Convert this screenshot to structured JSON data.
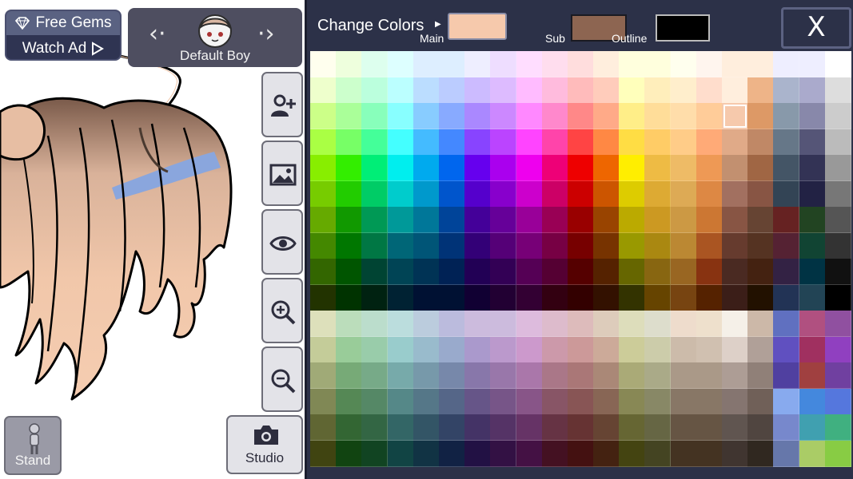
{
  "header": {
    "free_gems_label": "Free Gems",
    "watch_ad_label": "Watch Ad",
    "character_name": "Default Boy",
    "prev_arrow": "‹·",
    "next_arrow": "·›"
  },
  "side_buttons": [
    {
      "name": "add-character-button",
      "icon": "add-user-icon"
    },
    {
      "name": "background-button",
      "icon": "image-icon"
    },
    {
      "name": "visibility-button",
      "icon": "eye-icon"
    },
    {
      "name": "zoom-in-button",
      "icon": "zoom-in-icon"
    },
    {
      "name": "zoom-out-button",
      "icon": "zoom-out-icon"
    }
  ],
  "bottom_buttons": {
    "stand_label": "Stand",
    "studio_label": "Studio"
  },
  "color_panel": {
    "title": "Change Colors",
    "main_label": "Main",
    "sub_label": "Sub",
    "outline_label": "Outline",
    "close_label": "X",
    "main_color": "#f6c9ac",
    "sub_color": "#8d6551",
    "outline_color": "#000000",
    "selected_cell": {
      "row": 2,
      "col": 16
    }
  },
  "palette": {
    "rows": [
      [
        "#ffffee",
        "#eeffdd",
        "#ddffee",
        "#ddffff",
        "#ddeeff",
        "#ddeeff",
        "#eeeeff",
        "#eeddff",
        "#ffddff",
        "#ffddee",
        "#ffdddd",
        "#ffeedd",
        "#ffffdd",
        "#ffffdd",
        "#ffffee",
        "#fff5ee",
        "#ffeedd",
        "#ffeedd",
        "#eeeeff",
        "#eeeeff",
        "#ffffff"
      ],
      [
        "#eeffcc",
        "#ccffcc",
        "#bbffdd",
        "#bbffff",
        "#bbddff",
        "#bbccff",
        "#ccbbff",
        "#ddbbff",
        "#ffbbff",
        "#ffbbdd",
        "#ffbbbb",
        "#ffccbb",
        "#ffffbb",
        "#ffeebb",
        "#ffeecc",
        "#ffddcc",
        "#ffeedd",
        "#eeb488",
        "#aab4cc",
        "#aaaacc",
        "#dddddd"
      ],
      [
        "#ccff88",
        "#aaff99",
        "#88ffbb",
        "#88ffff",
        "#88ccff",
        "#88aaff",
        "#aa88ff",
        "#cc88ff",
        "#ff88ff",
        "#ff88cc",
        "#ff8888",
        "#ffaa88",
        "#ffee88",
        "#ffdd99",
        "#ffddaa",
        "#ffcc99",
        "#f6c9ac",
        "#dd9966",
        "#8899aa",
        "#8888aa",
        "#cccccc"
      ],
      [
        "#aaff44",
        "#77ff66",
        "#44ff99",
        "#44ffff",
        "#44bbff",
        "#4488ff",
        "#8844ff",
        "#bb44ff",
        "#ff44ff",
        "#ff44aa",
        "#ff4444",
        "#ff8844",
        "#ffdd44",
        "#ffcc66",
        "#ffcc88",
        "#ffaa77",
        "#e0aa88",
        "#c08866",
        "#667788",
        "#555577",
        "#bbbbbb"
      ],
      [
        "#88ee00",
        "#33ee00",
        "#00ee77",
        "#00eeee",
        "#00aaee",
        "#0066ee",
        "#6600ee",
        "#aa00ee",
        "#ee00ee",
        "#ee0077",
        "#ee0000",
        "#ee6600",
        "#ffee00",
        "#eebb44",
        "#eebb66",
        "#ee9955",
        "#c29070",
        "#a06644",
        "#445566",
        "#333355",
        "#999999"
      ],
      [
        "#77cc00",
        "#22cc00",
        "#00cc66",
        "#00cccc",
        "#0099cc",
        "#0055cc",
        "#5500cc",
        "#8800cc",
        "#cc00cc",
        "#cc0066",
        "#cc0000",
        "#cc5500",
        "#ddcc00",
        "#ddaa33",
        "#ddaa55",
        "#dd8844",
        "#a27060",
        "#885544",
        "#334455",
        "#222244",
        "#777777"
      ],
      [
        "#66aa00",
        "#119900",
        "#009955",
        "#009999",
        "#007799",
        "#004499",
        "#440099",
        "#660099",
        "#990099",
        "#990055",
        "#990000",
        "#994400",
        "#bbaa00",
        "#cc9922",
        "#cc9944",
        "#cc7733",
        "#885544",
        "#664433",
        "#662222",
        "#224422",
        "#555555"
      ],
      [
        "#448800",
        "#007700",
        "#007744",
        "#006677",
        "#005577",
        "#003377",
        "#330077",
        "#550077",
        "#770077",
        "#770044",
        "#770000",
        "#773300",
        "#999900",
        "#aa8811",
        "#bb8833",
        "#aa5522",
        "#663b2e",
        "#553322",
        "#552233",
        "#114433",
        "#333333"
      ],
      [
        "#336600",
        "#005500",
        "#004433",
        "#004455",
        "#003355",
        "#002255",
        "#220055",
        "#330055",
        "#550055",
        "#550033",
        "#550000",
        "#552200",
        "#666600",
        "#886611",
        "#996622",
        "#883311",
        "#4a2a22",
        "#442211",
        "#332244",
        "#003344",
        "#111111"
      ],
      [
        "#223300",
        "#003300",
        "#002211",
        "#002233",
        "#001133",
        "#001133",
        "#110033",
        "#220033",
        "#330033",
        "#330011",
        "#330000",
        "#331100",
        "#333300",
        "#664400",
        "#774411",
        "#552200",
        "#3b1e18",
        "#221100",
        "#223355",
        "#224455",
        "#000000"
      ],
      [
        "#dde0bb",
        "#bbddbb",
        "#bbddcc",
        "#bbdddd",
        "#bbccdd",
        "#bbbbdd",
        "#ccbbdd",
        "#ccbbdd",
        "#ddbbdd",
        "#ddbbcc",
        "#ddbbbb",
        "#ddccbb",
        "#ddddbb",
        "#ddddcc",
        "#eedccc",
        "#eee0cc",
        "#f5f0e8",
        "#ccb8a8",
        "#6070c0",
        "#b05080",
        "#9050a0"
      ],
      [
        "#c4cc99",
        "#99cc99",
        "#99ccaa",
        "#99cccc",
        "#99bbcc",
        "#99aacc",
        "#aa99cc",
        "#bb99cc",
        "#cc99cc",
        "#cc99aa",
        "#cc9999",
        "#ccaa99",
        "#cccc99",
        "#ccccaa",
        "#ccbbaa",
        "#d0c0b0",
        "#ddd0c8",
        "#b0a098",
        "#6050c0",
        "#a03060",
        "#9040c0"
      ],
      [
        "#a0aa77",
        "#77aa77",
        "#77aa88",
        "#77aaaa",
        "#7799aa",
        "#7788aa",
        "#8877aa",
        "#9977aa",
        "#aa77aa",
        "#aa7788",
        "#aa7777",
        "#aa8877",
        "#aaaa77",
        "#aaaa88",
        "#aa9988",
        "#aa9988",
        "#ad9d95",
        "#908078",
        "#5040a0",
        "#a04040",
        "#7040a0"
      ],
      [
        "#808855",
        "#558855",
        "#558866",
        "#558888",
        "#557788",
        "#556688",
        "#665588",
        "#775588",
        "#885588",
        "#885566",
        "#885555",
        "#886655",
        "#888855",
        "#888866",
        "#887766",
        "#887766",
        "#857570",
        "#706058",
        "#88aaee",
        "#4488dd",
        "#5577dd"
      ],
      [
        "#606633",
        "#336633",
        "#336644",
        "#336666",
        "#335566",
        "#334466",
        "#443366",
        "#553366",
        "#663366",
        "#663344",
        "#663333",
        "#664433",
        "#666633",
        "#666644",
        "#665544",
        "#665544",
        "#605550",
        "#504540",
        "#7788cc",
        "#40a0b0",
        "#40b080"
      ],
      [
        "#404411",
        "#114411",
        "#114422",
        "#114444",
        "#113344",
        "#112244",
        "#221144",
        "#331144",
        "#441144",
        "#441122",
        "#441111",
        "#442211",
        "#444411",
        "#444422",
        "#443322",
        "#443322",
        "#403530",
        "#302820",
        "#6677aa",
        "#aacc66",
        "#88cc44"
      ]
    ]
  }
}
